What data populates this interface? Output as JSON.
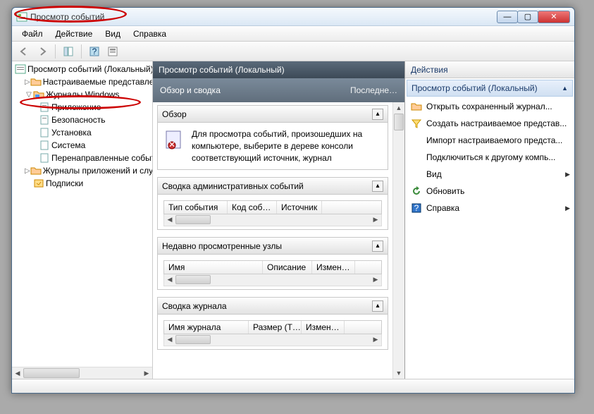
{
  "window": {
    "title": "Просмотр событий"
  },
  "menubar": [
    "Файл",
    "Действие",
    "Вид",
    "Справка"
  ],
  "tree": {
    "root": "Просмотр событий (Локальный)",
    "items": [
      {
        "label": "Настраиваемые представления",
        "level": 1,
        "expandable": true
      },
      {
        "label": "Журналы Windows",
        "level": 1,
        "expandable": true,
        "expanded": true
      },
      {
        "label": "Приложение",
        "level": 2
      },
      {
        "label": "Безопасность",
        "level": 2
      },
      {
        "label": "Установка",
        "level": 2
      },
      {
        "label": "Система",
        "level": 2
      },
      {
        "label": "Перенаправленные события",
        "level": 2
      },
      {
        "label": "Журналы приложений и служб",
        "level": 1,
        "expandable": true
      },
      {
        "label": "Подписки",
        "level": 1
      }
    ]
  },
  "center": {
    "header": "Просмотр событий (Локальный)",
    "overview_title": "Обзор и сводка",
    "overview_right": "Последне…",
    "sections": {
      "overview": {
        "title": "Обзор",
        "text": "Для просмотра событий, произошедших на компьютере, выберите в дереве консоли соответствующий источник, журнал"
      },
      "admin": {
        "title": "Сводка административных событий",
        "cols": [
          "Тип события",
          "Код соб…",
          "Источник"
        ]
      },
      "recent": {
        "title": "Недавно просмотренные узлы",
        "cols": [
          "Имя",
          "Описание",
          "Измен…"
        ]
      },
      "log_summary": {
        "title": "Сводка журнала",
        "cols": [
          "Имя журнала",
          "Размер (Т…",
          "Измен…"
        ]
      }
    }
  },
  "actions": {
    "header": "Действия",
    "group": "Просмотр событий (Локальный)",
    "items": [
      {
        "label": "Открыть сохраненный журнал...",
        "icon": "folder"
      },
      {
        "label": "Создать настраиваемое представ...",
        "icon": "filter"
      },
      {
        "label": "Импорт настраиваемого предста...",
        "icon": "none"
      },
      {
        "label": "Подключиться к другому компь...",
        "icon": "none"
      },
      {
        "label": "Вид",
        "icon": "none",
        "submenu": true
      },
      {
        "label": "Обновить",
        "icon": "refresh"
      },
      {
        "label": "Справка",
        "icon": "help",
        "submenu": true
      }
    ]
  }
}
